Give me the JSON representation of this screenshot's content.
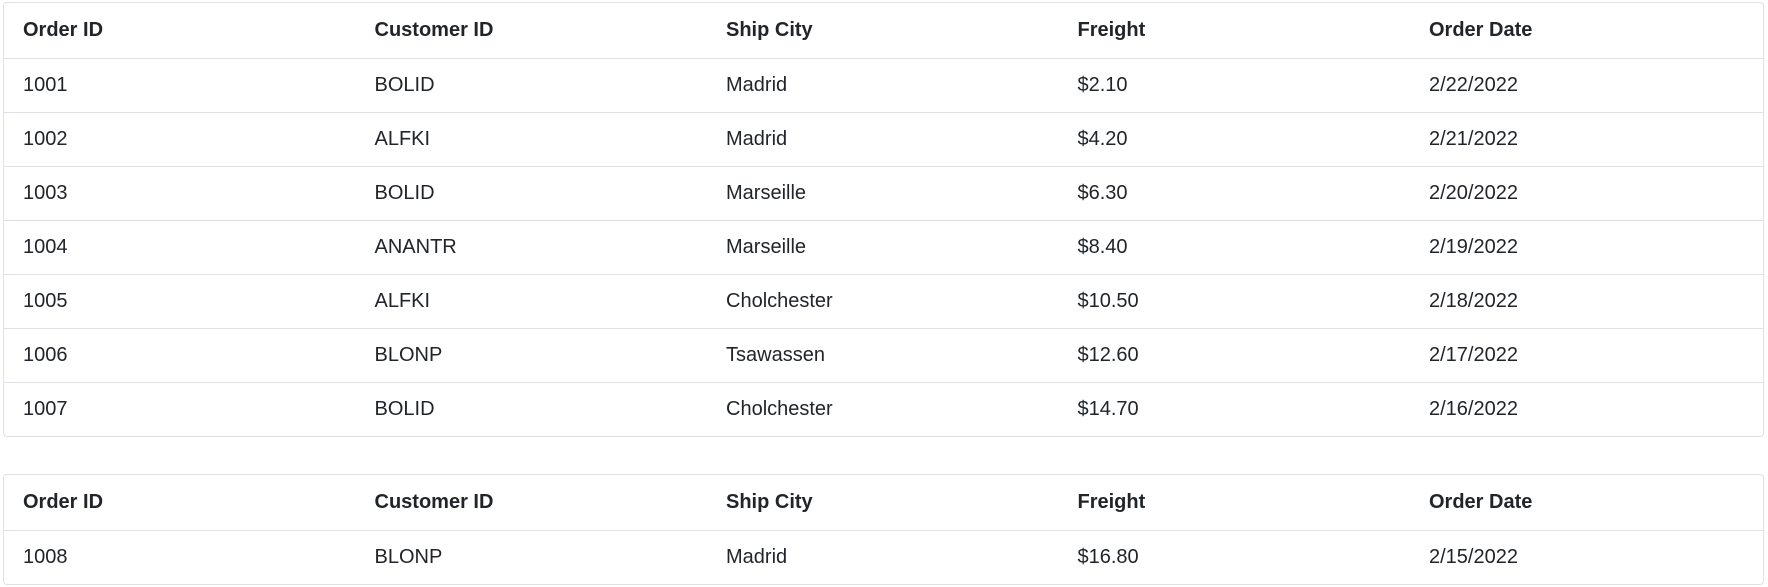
{
  "columns": [
    "Order ID",
    "Customer ID",
    "Ship City",
    "Freight",
    "Order Date"
  ],
  "tables": [
    {
      "rows": [
        [
          "1001",
          "BOLID",
          "Madrid",
          "$2.10",
          "2/22/2022"
        ],
        [
          "1002",
          "ALFKI",
          "Madrid",
          "$4.20",
          "2/21/2022"
        ],
        [
          "1003",
          "BOLID",
          "Marseille",
          "$6.30",
          "2/20/2022"
        ],
        [
          "1004",
          "ANANTR",
          "Marseille",
          "$8.40",
          "2/19/2022"
        ],
        [
          "1005",
          "ALFKI",
          "Cholchester",
          "$10.50",
          "2/18/2022"
        ],
        [
          "1006",
          "BLONP",
          "Tsawassen",
          "$12.60",
          "2/17/2022"
        ],
        [
          "1007",
          "BOLID",
          "Cholchester",
          "$14.70",
          "2/16/2022"
        ]
      ]
    },
    {
      "rows": [
        [
          "1008",
          "BLONP",
          "Madrid",
          "$16.80",
          "2/15/2022"
        ]
      ]
    }
  ]
}
